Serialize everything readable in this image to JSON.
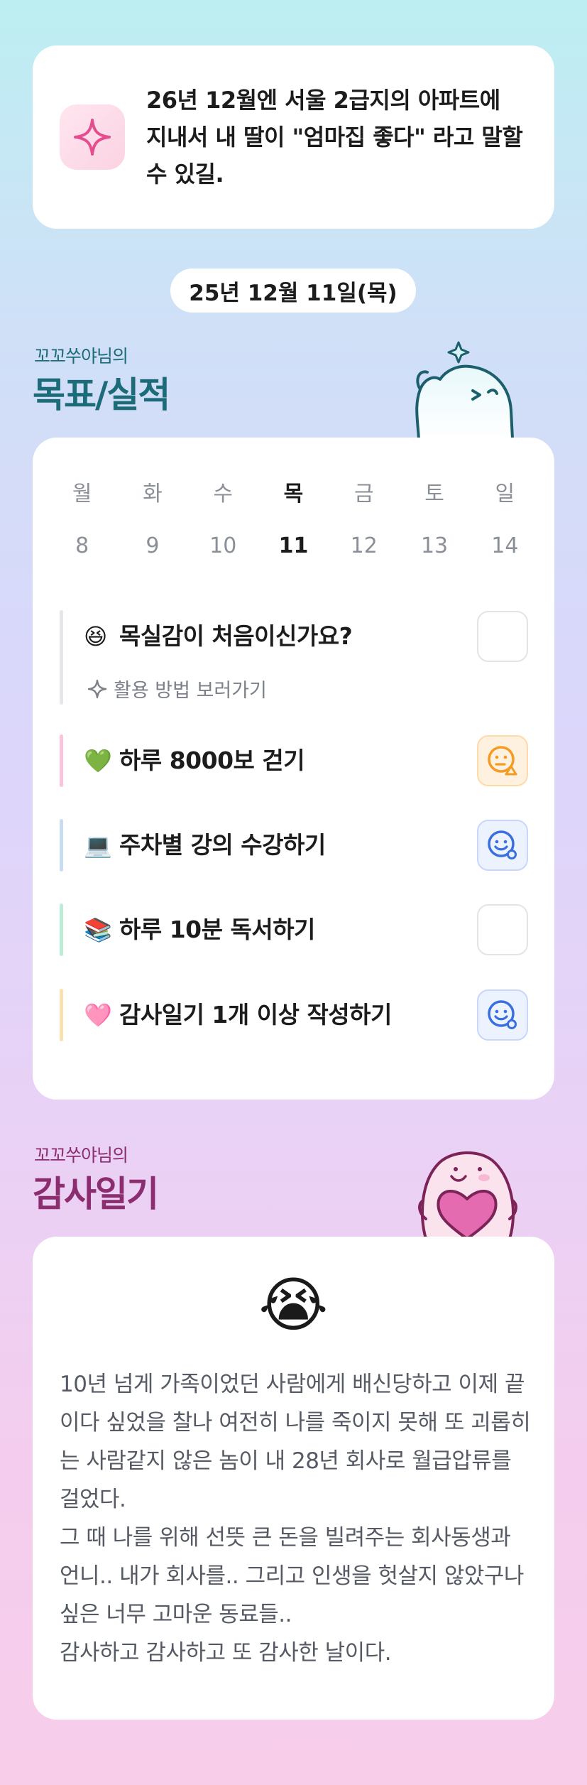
{
  "goal": {
    "icon": "sparkle-icon",
    "text": "26년 12월엔 서울 2급지의 아파트에 지내서 내 딸이 \"엄마집 좋다\" 라고 말할수 있길."
  },
  "date_label": "25년 12월 11일(목)",
  "goals_section": {
    "subtitle": "꼬꼬쑤야님의",
    "title": "목표/실적"
  },
  "week": {
    "days": [
      "월",
      "화",
      "수",
      "목",
      "금",
      "토",
      "일"
    ],
    "dates": [
      "8",
      "9",
      "10",
      "11",
      "12",
      "13",
      "14"
    ],
    "today_index": 3
  },
  "tasks": [
    {
      "emoji": "😆",
      "label": "목실감이 처음이신가요?",
      "bar_color": "#e4e6ea",
      "status": "empty"
    },
    {
      "emoji": "💚",
      "label": "하루 8000보 걷기",
      "bar_color": "#f9c4dc",
      "status": "partial"
    },
    {
      "emoji": "💻",
      "label": "주차별 강의 수강하기",
      "bar_color": "#c8dcf2",
      "status": "done"
    },
    {
      "emoji": "📚",
      "label": "하루 10분 독서하기",
      "bar_color": "#bdecd6",
      "status": "empty"
    },
    {
      "emoji": "🩷",
      "label": "감사일기 1개 이상 작성하기",
      "bar_color": "#fbe0b0",
      "status": "done"
    }
  ],
  "hint_label": "활용 방법 보러가기",
  "diary_section": {
    "subtitle": "꼬꼬쑤야님의",
    "title": "감사일기"
  },
  "diary": {
    "mood_emoji": "😭",
    "text": "10년 넘게 가족이었던 사람에게 배신당하고 이제 끝이다 싶었을 찰나 여전히 나를 죽이지 못해 또 괴롭히는 사람같지 않은 놈이 내 28년 회사로 월급압류를 걸었다.\n그 때 나를 위해 선뜻 큰 돈을 빌려주는 회사동생과 언니..  내가 회사를..  그리고 인생을 헛살지 않았구나 싶은 너무 고마운 동료들..\n감사하고 감사하고 또 감사한 날이다."
  },
  "colors": {
    "teal_title": "#1c6b78",
    "pink_title": "#8b2d6e",
    "partial_orange": "#f59a23",
    "done_blue": "#3a6fe0"
  }
}
